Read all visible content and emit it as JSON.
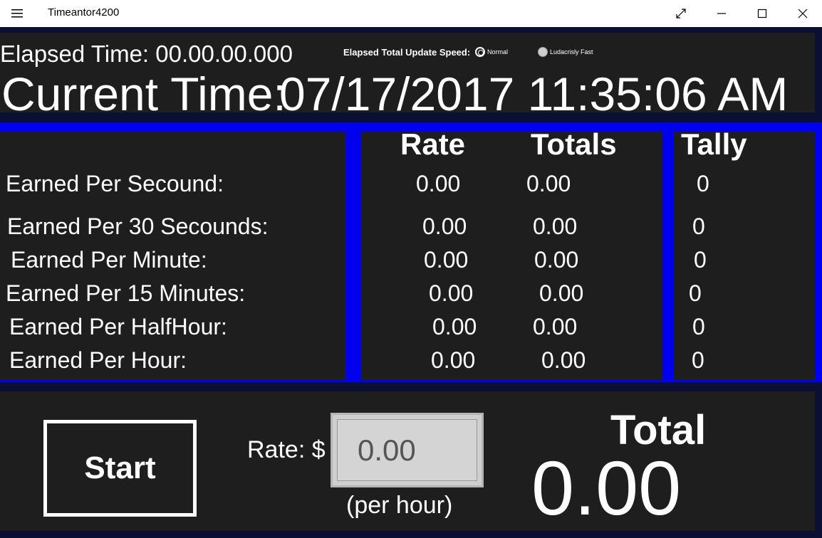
{
  "window": {
    "title": "Timeantor4200",
    "menu_icon": "hamburger-icon",
    "controls": [
      "expand-icon",
      "minimize-icon",
      "maximize-icon",
      "close-icon"
    ]
  },
  "header": {
    "elapsed_label": "Elapsed Time: 00.00.00.000",
    "speed_label": "Elapsed Total Update Speed:",
    "speed_options": [
      {
        "label": "Normal",
        "selected": true
      },
      {
        "label": "Ludacrisly Fast",
        "selected": false
      }
    ],
    "current_label": "Current Time:",
    "current_value": "07/17/2017 11:35:06 AM"
  },
  "table": {
    "headers": {
      "rate": "Rate",
      "totals": "Totals",
      "tally": "Tally"
    },
    "rows": [
      {
        "label": "Earned Per Secound:",
        "rate": "0.00",
        "total": "0.00",
        "tally": "0"
      },
      {
        "label": "Earned Per 30 Secounds:",
        "rate": "0.00",
        "total": "0.00",
        "tally": "0"
      },
      {
        "label": "Earned Per Minute:",
        "rate": "0.00",
        "total": "0.00",
        "tally": "0"
      },
      {
        "label": "Earned Per 15 Minutes:",
        "rate": "0.00",
        "total": "0.00",
        "tally": "0"
      },
      {
        "label": "Earned Per HalfHour:",
        "rate": "0.00",
        "total": "0.00",
        "tally": "0"
      },
      {
        "label": "Earned Per Hour:",
        "rate": "0.00",
        "total": "0.00",
        "tally": "0"
      }
    ]
  },
  "controls": {
    "start_label": "Start",
    "rate_label": "Rate: $",
    "rate_placeholder": "0.00",
    "per_hour": "(per hour)",
    "total_label": "Total",
    "total_value": "0.00"
  },
  "colors": {
    "accent_blue": "#0000ee",
    "panel": "#1e1e1e",
    "background": "#0a0f33",
    "text": "#ffffff"
  }
}
